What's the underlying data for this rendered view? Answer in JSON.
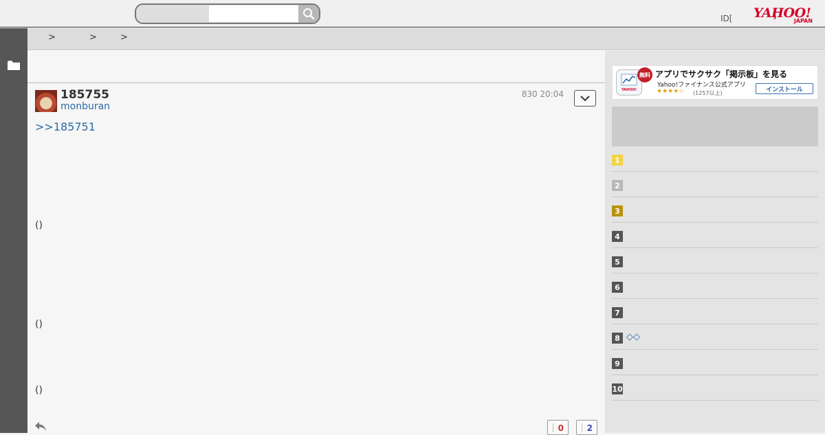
{
  "header": {
    "search_placeholder": "",
    "id_label": "ID[",
    "id_bracket": "]",
    "logo": {
      "main": "YAHOO!",
      "sub": "JAPAN"
    }
  },
  "breadcrumb": {
    "separators": [
      ">",
      ">",
      ">"
    ]
  },
  "post": {
    "number": "185755",
    "username": "monburan",
    "datetime": "830 20:04",
    "reply_to": ">>185751",
    "paragraphs": [
      "()",
      "()",
      "()"
    ]
  },
  "votes": {
    "bad": "0",
    "good": "2"
  },
  "colors": {
    "bad": "#c0392b",
    "good": "#3b4bb0",
    "link": "#2b6aa8",
    "rail": "#565656"
  },
  "ad": {
    "free_badge": "無料",
    "title": "アプリでサクサク「掲示板」を見る",
    "subtitle": "Yahoo!ファイナンス公式アプリ",
    "stars": "★★★★☆",
    "rating_count": "(1257以上)",
    "install_label": "インストール"
  },
  "ranking": [
    {
      "rank": "1",
      "title": "",
      "color": "#f2d34a"
    },
    {
      "rank": "2",
      "title": "",
      "color": "#b8b8b8"
    },
    {
      "rank": "3",
      "title": "",
      "color": "#b8920c"
    },
    {
      "rank": "4",
      "title": "",
      "color": "#555555"
    },
    {
      "rank": "5",
      "title": "",
      "color": "#555555"
    },
    {
      "rank": "6",
      "title": "",
      "color": "#555555"
    },
    {
      "rank": "7",
      "title": "",
      "color": "#555555"
    },
    {
      "rank": "8",
      "title": "◇◇",
      "color": "#555555"
    },
    {
      "rank": "9",
      "title": "",
      "color": "#555555"
    },
    {
      "rank": "10",
      "title": "",
      "color": "#555555"
    }
  ],
  "icons": [
    "search-icon",
    "folder-icon",
    "chevron-down-icon",
    "reply-icon"
  ]
}
